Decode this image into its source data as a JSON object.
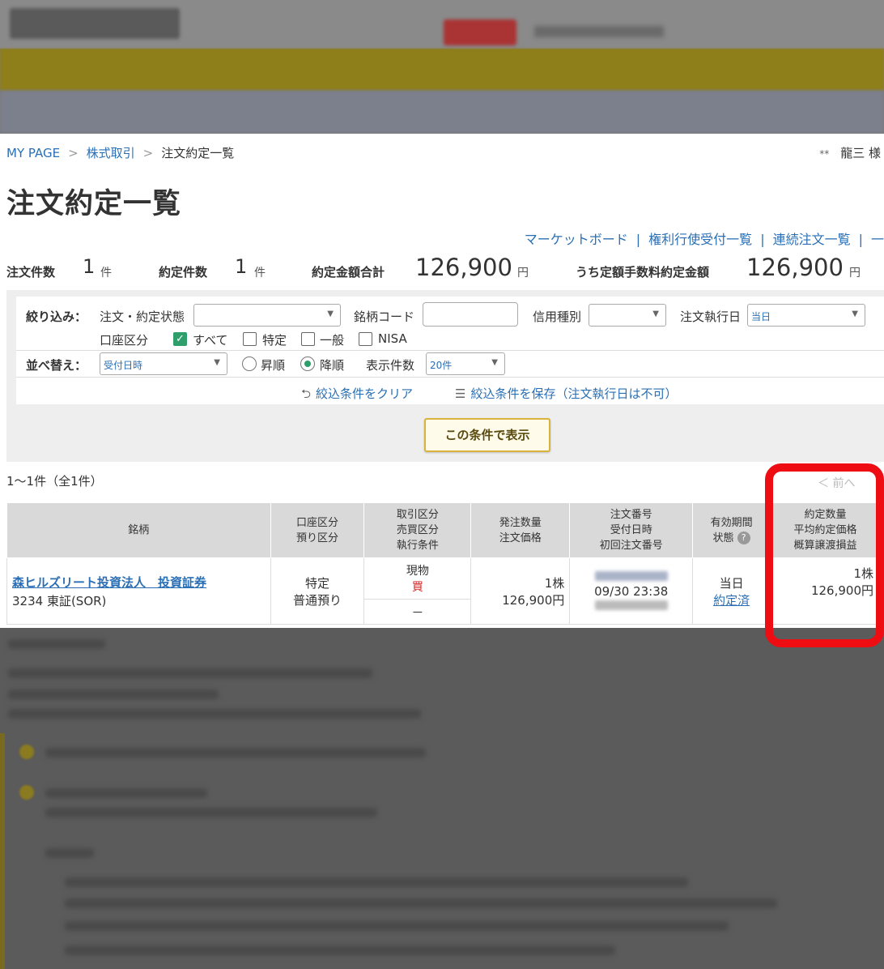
{
  "breadcrumb": {
    "home": "MY PAGE",
    "sep1": ">",
    "section": "株式取引",
    "sep2": ">",
    "current": "注文約定一覧"
  },
  "user": {
    "stars": "**",
    "name": "龍三 様"
  },
  "page_title": "注文約定一覧",
  "links": {
    "market_board": "マーケットボード",
    "rights": "権利行使受付一覧",
    "continuous": "連続注文一覧",
    "bar": "|",
    "trailing": "|",
    "more": "一"
  },
  "summary": {
    "order_count_label": "注文件数",
    "order_count": "1",
    "order_unit": "件",
    "exec_count_label": "約定件数",
    "exec_count": "1",
    "exec_unit": "件",
    "exec_total_label": "約定金額合計",
    "exec_total": "126,900",
    "exec_total_unit": "円",
    "specific_label": "うち定額手数料約定金額",
    "specific_total": "126,900",
    "specific_unit": "円"
  },
  "filter": {
    "narrow_label": "絞り込み：",
    "status_label": "注文・約定状態",
    "status_value": "",
    "code_label": "銘柄コード",
    "code_value": "",
    "credit_label": "信用種別",
    "credit_value": "",
    "exec_date_label": "注文執行日",
    "exec_date_value": "当日",
    "account_label": "口座区分",
    "acc_all": "すべて",
    "acc_tokutei": "特定",
    "acc_ippan": "一般",
    "acc_nisa": "NISA",
    "sort_label": "並べ替え：",
    "sort_value": "受付日時",
    "asc": "昇順",
    "desc": "降順",
    "per_page_label": "表示件数",
    "per_page_value": "20件",
    "clear_link": "絞込条件をクリア",
    "save_link": "絞込条件を保存（注文執行日は不可）",
    "show_button": "この条件で表示",
    "check_mark": "✓",
    "select_arrow": "▼",
    "clear_icon": "⮌",
    "save_icon": "☰"
  },
  "results": {
    "count_text": "1〜1件（全1件）",
    "prev": "＜ 前へ",
    "headers": {
      "stock": "銘柄",
      "account": [
        "口座区分",
        "預り区分"
      ],
      "trade": [
        "取引区分",
        "売買区分",
        "執行条件"
      ],
      "qty": [
        "発注数量",
        "注文価格"
      ],
      "order_no": [
        "注文番号",
        "受付日時",
        "初回注文番号"
      ],
      "validity": [
        "有効期間",
        "状態"
      ],
      "exec": [
        "約定数量",
        "平均約定価格",
        "概算譲渡損益"
      ]
    },
    "help_icon": "?",
    "row": {
      "stock_name": "森ヒルズリート投資法人　投資証券",
      "stock_code": "3234 東証(SOR)",
      "account": "特定",
      "custody": "普通預り",
      "trade_type": "現物",
      "side": "買",
      "exec_cond": "－",
      "order_qty": "1株",
      "order_price": "126,900円",
      "received": "09/30 23:38",
      "validity": "当日",
      "status": "約定済",
      "exec_qty": "1株",
      "avg_price": "126,900円"
    }
  },
  "colors": {
    "link": "#2a6fb5",
    "highlight": "#ee0d12",
    "button_border": "#d9b33c",
    "header_bg": "#d9d9d9"
  }
}
